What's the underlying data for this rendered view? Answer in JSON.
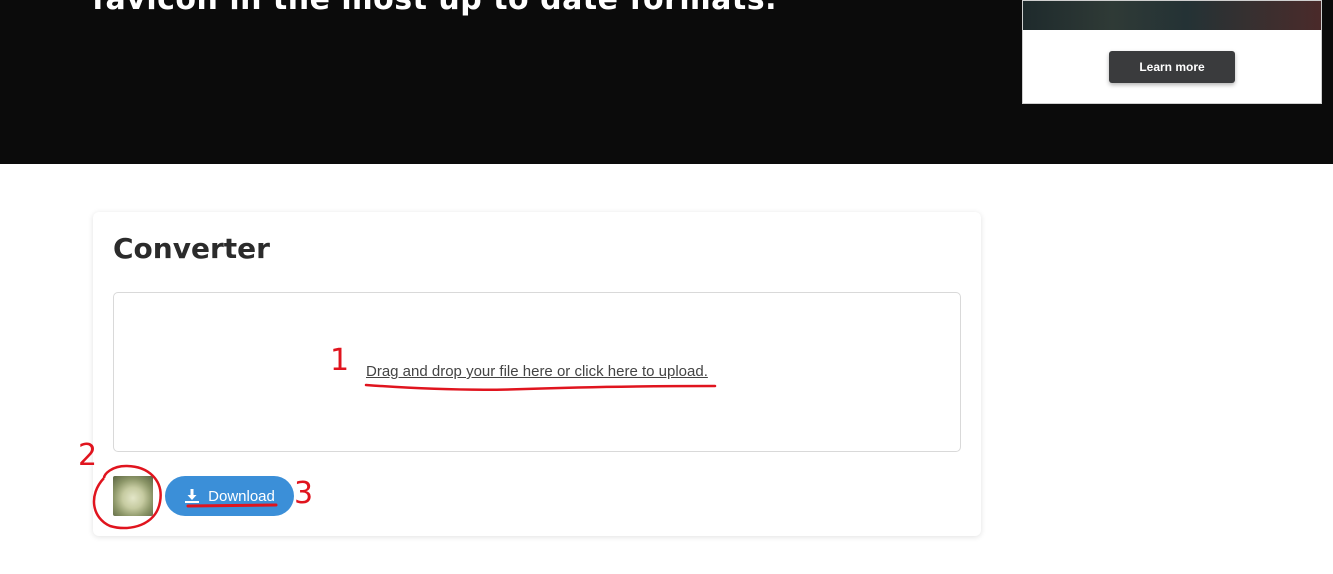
{
  "hero": {
    "headline": "favicon in the most up to date formats."
  },
  "ad": {
    "button_label": "Learn more"
  },
  "converter": {
    "title": "Converter",
    "dropzone_text": "Drag and drop your file here or click here to upload.",
    "download_label": "Download",
    "download_icon": "download-icon",
    "thumbnail_icon": "uploaded-image-thumbnail"
  },
  "annotations": {
    "labels": [
      "1",
      "2",
      "3"
    ],
    "color": "#e0141e"
  },
  "colors": {
    "hero_bg": "#0b0b0b",
    "accent": "#3b8fd8",
    "ad_button": "#3a3b3d"
  }
}
